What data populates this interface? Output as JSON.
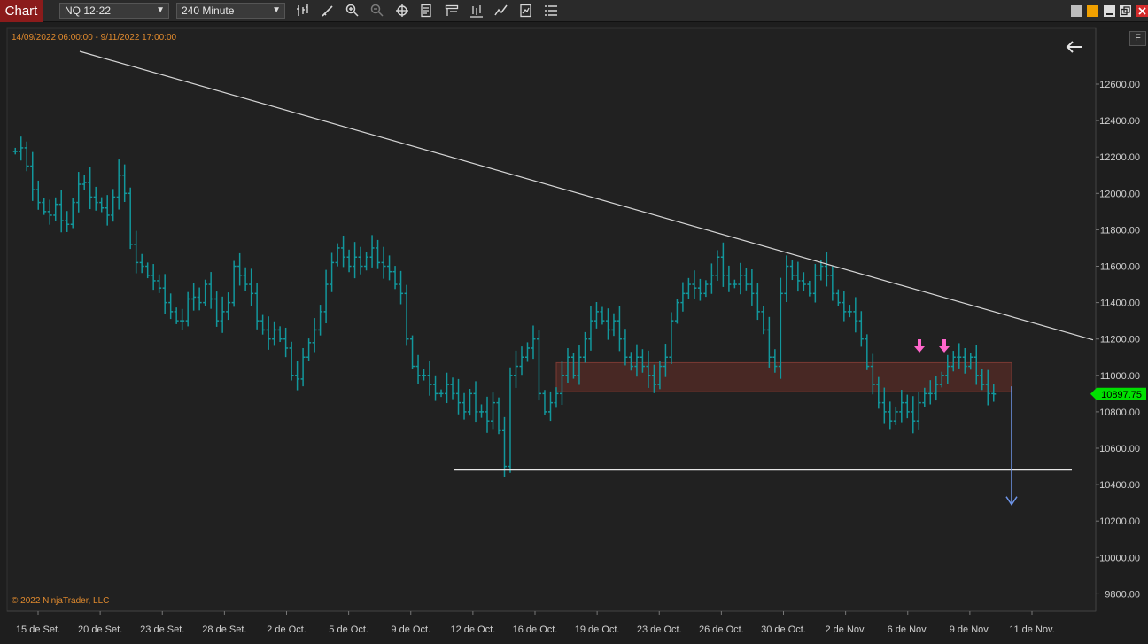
{
  "toolbar": {
    "tab_label": "Chart",
    "instrument": "NQ 12-22",
    "interval": "240 Minute",
    "tools": [
      "bar-type-icon",
      "pencil-icon",
      "zoom-in-icon",
      "zoom-out-icon",
      "crosshair-icon",
      "properties-icon",
      "templates-icon",
      "data-series-icon",
      "indicators-icon",
      "strategy-icon",
      "list-icon"
    ],
    "window_colors": [
      "#bdbdbd",
      "#f0a000"
    ]
  },
  "header": {
    "date_range": "14/09/2022 06:00:00 - 9/11/2022 17:00:00",
    "f_label": "F"
  },
  "footer": {
    "copyright": "© 2022 NinjaTrader, LLC"
  },
  "colors": {
    "bars": "#12979c",
    "price_marker": "#00e000",
    "zone": "#5a2c27",
    "zone_border": "#7a3a33",
    "target_arrow": "#6f95e8",
    "signal_arrows": "#ff66cc",
    "axis_text": "#d0d0d0"
  },
  "chart_data": {
    "type": "ohlc",
    "instrument": "NQ 12-22",
    "interval": "240 Minute",
    "ylim": [
      9700,
      12800
    ],
    "y_ticks": [
      9800,
      10000,
      10200,
      10400,
      10600,
      10800,
      11000,
      11200,
      11400,
      11600,
      11800,
      12000,
      12200,
      12400,
      12600
    ],
    "y_tick_labels": [
      "9800.00",
      "10000.00",
      "10200.00",
      "10400.00",
      "10600.00",
      "10800.00",
      "11000.00",
      "11200.00",
      "11400.00",
      "11600.00",
      "11800.00",
      "12000.00",
      "12200.00",
      "12400.00",
      "12600.00"
    ],
    "x_labels": [
      "15 de Set.",
      "20 de Set.",
      "23 de Set.",
      "28 de Set.",
      "2 de Oct.",
      "5 de Oct.",
      "9 de Oct.",
      "12 de Oct.",
      "16 de Oct.",
      "19 de Oct.",
      "23 de Oct.",
      "26 de Oct.",
      "30 de Oct.",
      "2 de Nov.",
      "6 de Nov.",
      "9 de Nov.",
      "11 de Nov."
    ],
    "last_price": 10897.75,
    "last_price_label": "10897.75",
    "path": [
      12230,
      12250,
      12150,
      12020,
      11950,
      11900,
      11880,
      11940,
      11850,
      11830,
      11950,
      12050,
      12060,
      11980,
      11950,
      11920,
      11880,
      11980,
      12100,
      12000,
      11720,
      11620,
      11600,
      11550,
      11520,
      11480,
      11400,
      11350,
      11300,
      11300,
      11420,
      11430,
      11400,
      11500,
      11420,
      11300,
      11350,
      11400,
      11600,
      11550,
      11500,
      11450,
      11300,
      11250,
      11200,
      11250,
      11200,
      11150,
      11000,
      10980,
      11100,
      11180,
      11250,
      11350,
      11500,
      11620,
      11700,
      11650,
      11600,
      11650,
      11600,
      11650,
      11700,
      11620,
      11600,
      11570,
      11500,
      11450,
      11200,
      11050,
      11000,
      11000,
      10950,
      10900,
      10900,
      10950,
      10900,
      10850,
      10800,
      10900,
      10800,
      10800,
      10750,
      10850,
      10700,
      10500,
      11000,
      11050,
      11100,
      11150,
      11200,
      10900,
      10800,
      10850,
      10900,
      11000,
      11100,
      11000,
      11100,
      11200,
      11300,
      11350,
      11300,
      11250,
      11300,
      11200,
      11100,
      11050,
      11100,
      11050,
      11000,
      10950,
      11050,
      11100,
      11300,
      11400,
      11450,
      11500,
      11480,
      11450,
      11500,
      11550,
      11650,
      11550,
      11500,
      11500,
      11550,
      11500,
      11450,
      11350,
      11250,
      11100,
      11050,
      11450,
      11600,
      11550,
      11520,
      11500,
      11450,
      11550,
      11600,
      11550,
      11450,
      11400,
      11350,
      11350,
      11300,
      11200,
      11050,
      10950,
      10850,
      10800,
      10750,
      10800,
      10850,
      10800,
      10750,
      10850,
      10900,
      10900,
      10950,
      11000,
      11050,
      11100,
      11100,
      11050,
      11100,
      11000,
      10950,
      10900,
      10897.75
    ],
    "channel_low": 10910,
    "channel_high": 11070,
    "drawings": {
      "trendline": {
        "start_price": 12780,
        "end_price": 11195
      },
      "support_line": {
        "price": 10480
      },
      "target_arrow": {
        "from_price": 10940,
        "to_price": 10290
      },
      "signal_arrows": 2
    }
  }
}
